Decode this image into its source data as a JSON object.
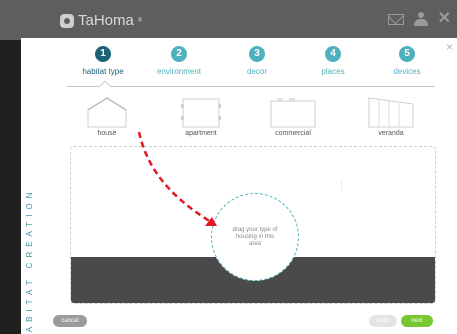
{
  "app": {
    "name": "TaHoma",
    "trademark": "®"
  },
  "wizard": {
    "steps": [
      {
        "num": "1",
        "label": "habitat type",
        "active": true
      },
      {
        "num": "2",
        "label": "environment",
        "active": false
      },
      {
        "num": "3",
        "label": "decor",
        "active": false
      },
      {
        "num": "4",
        "label": "places",
        "active": false
      },
      {
        "num": "5",
        "label": "devices",
        "active": false
      }
    ],
    "side_title": "HABITAT CREATION",
    "close_label": "×"
  },
  "habitats": [
    {
      "label": "house",
      "icon": "house-icon"
    },
    {
      "label": "apartment",
      "icon": "apartment-icon"
    },
    {
      "label": "commercial",
      "icon": "commercial-icon"
    },
    {
      "label": "veranda",
      "icon": "veranda-icon"
    }
  ],
  "dropzone": {
    "hint": "drag your type of housing in this area"
  },
  "buttons": {
    "cancel": "cancel",
    "back": "back",
    "next": "next"
  },
  "colors": {
    "accent": "#4fb1bf",
    "active": "#1d6378",
    "next": "#78c832",
    "arrow": "#e0191f"
  }
}
